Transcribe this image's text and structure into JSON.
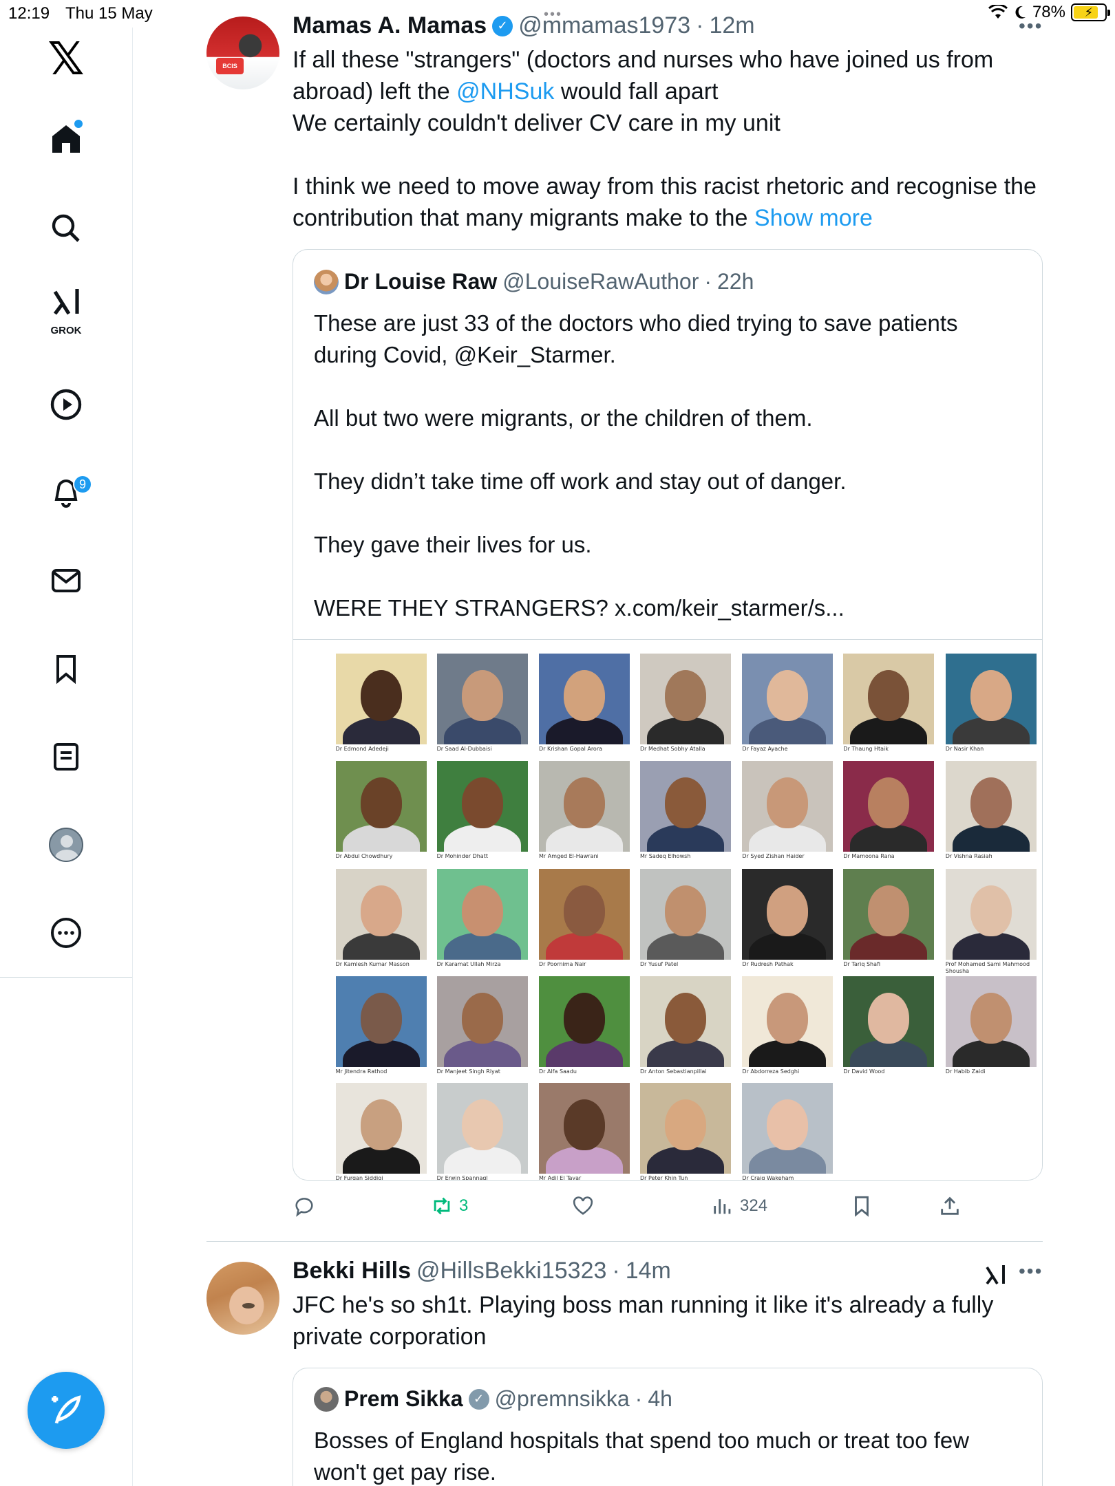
{
  "status_bar": {
    "time": "12:19",
    "date": "Thu 15 May",
    "battery": "78%",
    "multitask_dots": "•••"
  },
  "sidebar": {
    "items": [
      {
        "name": "x-logo",
        "icon": "x-logo-icon"
      },
      {
        "name": "home",
        "icon": "home-icon",
        "has_dot": true
      },
      {
        "name": "explore",
        "icon": "search-icon"
      },
      {
        "name": "grok",
        "icon": "grok-icon",
        "label": "GROK"
      },
      {
        "name": "video",
        "icon": "play-icon"
      },
      {
        "name": "notifications",
        "icon": "bell-icon",
        "badge": "9"
      },
      {
        "name": "messages",
        "icon": "envelope-icon"
      },
      {
        "name": "bookmarks",
        "icon": "bookmark-icon"
      },
      {
        "name": "lists",
        "icon": "list-icon"
      },
      {
        "name": "profile",
        "icon": "avatar-icon"
      },
      {
        "name": "more",
        "icon": "more-circle-icon"
      }
    ],
    "compose": {
      "icon": "compose-feather-icon"
    }
  },
  "colors": {
    "accent": "#1d9bf0",
    "retweet": "#00ba7c",
    "muted": "#536471",
    "border": "#cfd9de"
  },
  "posts": [
    {
      "name": "Mamas A. Mamas",
      "handle": "@mmamas1973",
      "separator": "·",
      "time": "12m",
      "text_line1": "If all these \"strangers\" (doctors and nurses who have joined us from",
      "text_line2_a": "abroad) left the ",
      "text_line2_link": "@NHSuk",
      "text_line2_b": " would fall apart",
      "text_line3": "We certainly couldn't deliver CV care in my unit",
      "text_line4": "I think we need to move away from this racist rhetoric and recognise the",
      "text_line5_a": "contribution that many migrants make to the ",
      "show_more": "Show more",
      "more": "•••",
      "quote": {
        "name": "Dr Louise Raw",
        "handle": "@LouiseRawAuthor",
        "separator": "·",
        "time": "22h",
        "line1": "These are just 33 of the doctors who died trying to save patients",
        "line2": "during Covid, @Keir_Starmer.",
        "line3": "All but two were migrants, or the children of them.",
        "line4": "They didn’t take time off work and stay out of danger.",
        "line5": "They gave their lives for us.",
        "line6": "WERE THEY STRANGERS? x.com/keir_starmer/s..."
      },
      "doctors": [
        "Dr Edmond Adedeji",
        "Dr Saad Al-Dubbaisi",
        "Dr Krishan Gopal Arora",
        "Dr Medhat Sobhy Atalla",
        "Dr Fayaz Ayache",
        "Dr Thaung Htaik",
        "Dr Nasir Khan",
        "Dr Abdul Chowdhury",
        "Dr Mohinder Dhatt",
        "Mr Amged El-Hawrani",
        "Mr Sadeq Elhowsh",
        "Dr Syed Zishan Haider",
        "Dr Mamoona Rana",
        "Dr Vishna Rasiah",
        "Dr Kamlesh Kumar Masson",
        "Dr Karamat Ullah Mirza",
        "Dr Poornima Nair",
        "Dr Yusuf Patel",
        "Dr Rudresh Pathak",
        "Dr Tariq Shafi",
        "Prof Mohamed Sami Mahmood Shousha",
        "Mr Jitendra Rathod",
        "Dr Manjeet Singh Riyat",
        "Dr Alfa Saadu",
        "Dr Anton Sebastianpillai",
        "Dr Abdorreza Sedghi",
        "Dr David Wood",
        "Dr Habib Zaidi",
        "Dr Furqan Siddiqi",
        "Dr Erwin Spannagl",
        "Mr Adil El Tayar",
        "Dr Peter Khin Tun",
        "Dr Craig Wakeham"
      ],
      "actions": {
        "reply_count": "",
        "retweet_count": "3",
        "like_count": "",
        "views_count": "324"
      }
    },
    {
      "name": "Bekki Hills",
      "handle": "@HillsBekki15323",
      "separator": "·",
      "time": "14m",
      "text_line1": "JFC he's so sh1t. Playing boss man running it like it's already a fully",
      "text_line2": "private corporation",
      "more": "•••",
      "quote": {
        "name": "Prem Sikka",
        "handle": "@premnsikka",
        "separator": "·",
        "time": "4h",
        "line1": "Bosses of England hospitals that spend too much or treat too few",
        "line2": "won't get pay rise."
      }
    }
  ]
}
